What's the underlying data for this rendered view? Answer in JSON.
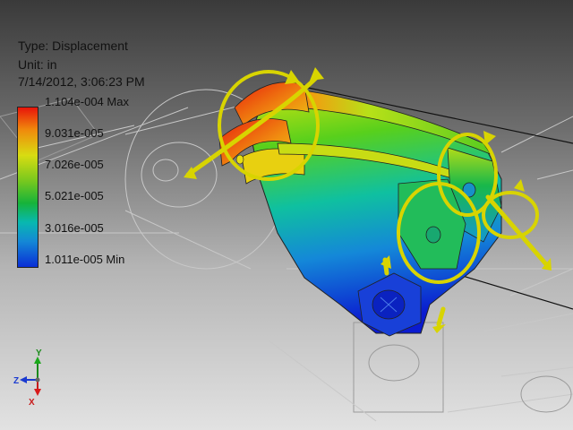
{
  "result_info": {
    "type": "Type: Displacement",
    "unit": "Unit: in",
    "timestamp": "7/14/2012, 3:06:23 PM"
  },
  "legend": {
    "labels": [
      "1.104e-004 Max",
      "9.031e-005",
      "7.026e-005",
      "5.021e-005",
      "3.016e-005",
      "1.011e-005 Min"
    ],
    "colors": [
      "#e8140a",
      "#d8dc12",
      "#78c81e",
      "#16b33a",
      "#08b8b0",
      "#0a2ed6"
    ]
  },
  "triad": {
    "x": "X",
    "y": "Y",
    "z": "Z"
  },
  "colors": {
    "background_top": "#3a3a3a",
    "background_bottom": "#e2e2e2",
    "load_arrows": "#d8d400"
  }
}
